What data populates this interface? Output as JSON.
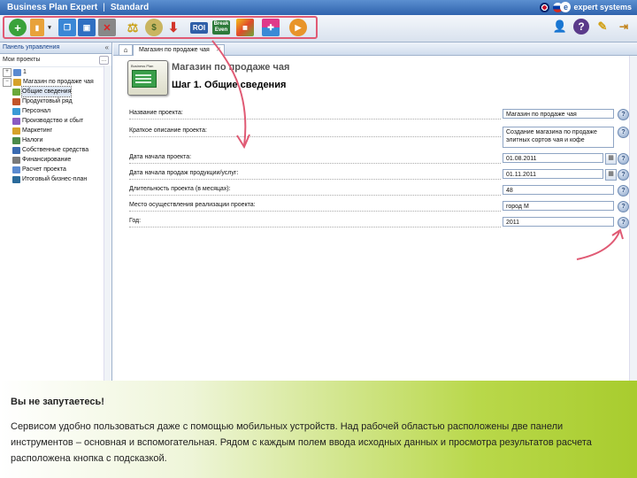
{
  "app": {
    "brand": "Business Plan Expert",
    "separator": "|",
    "edition": "Standard",
    "logo_text": "expert systems"
  },
  "toolbar": {
    "buttons": [
      {
        "name": "add-icon",
        "glyph": "+"
      },
      {
        "name": "open-icon",
        "glyph": "▮"
      },
      {
        "name": "copy-icon",
        "glyph": "❐"
      },
      {
        "name": "save-icon",
        "glyph": "💾"
      },
      {
        "name": "delete-icon",
        "glyph": "✕"
      },
      {
        "name": "balance-icon",
        "glyph": "⚖"
      },
      {
        "name": "money-bag-icon",
        "glyph": "$"
      },
      {
        "name": "export-icon",
        "glyph": "↓"
      }
    ],
    "roi_label": "ROI",
    "break_even_label": "Break Even",
    "right_buttons": [
      "users-icon",
      "help-icon",
      "edit-icon",
      "exit-icon"
    ]
  },
  "left_panel": {
    "title": "Панель управления",
    "projects_label": "Мои проекты",
    "tree": [
      {
        "label": "1",
        "level": 1,
        "toggle": "+"
      },
      {
        "label": "Магазин по продаже чая",
        "level": 1,
        "toggle": "−"
      },
      {
        "label": "Общие сведения",
        "level": 2,
        "selected": true
      },
      {
        "label": "Продуктовый ряд",
        "level": 2
      },
      {
        "label": "Персонал",
        "level": 2
      },
      {
        "label": "Производство и сбыт",
        "level": 2
      },
      {
        "label": "Маркетинг",
        "level": 2
      },
      {
        "label": "Налоги",
        "level": 2
      },
      {
        "label": "Собственные средства",
        "level": 2
      },
      {
        "label": "Финансирование",
        "level": 2
      },
      {
        "label": "Расчет проекта",
        "level": 2
      },
      {
        "label": "Итоговый бизнес-план",
        "level": 2
      }
    ]
  },
  "tabs": {
    "active_label": "Магазин по продаже чая"
  },
  "main": {
    "shop_title": "Магазин по продаже чая",
    "step_title": "Шаг 1. Общие сведения",
    "icon_caption": "Business Plan",
    "fields": [
      {
        "label": "Название проекта:",
        "value": "Магазин по продаже чая"
      },
      {
        "label": "Краткое описание проекта:",
        "value": "Создание магазина по продаже\nэлитных сортов чая и кофе"
      },
      {
        "label": "Дата начала проекта:",
        "value": "01.08.2011"
      },
      {
        "label": "Дата начала продаж продукции/услуг:",
        "value": "01.11.2011"
      },
      {
        "label": "Длительность проекта (в месяцах):",
        "value": "48"
      },
      {
        "label": "Место осуществления реализации проекта:",
        "value": "город М"
      },
      {
        "label": "Год:",
        "value": "2011"
      }
    ]
  },
  "info": {
    "title": "Вы не запутаетесь!",
    "body": "Сервисом удобно пользоваться даже с помощью мобильных устройств. Над рабочей областью расположены две панели инструментов – основная и вспомогательная. Рядом с каждым полем ввода исходных данных и просмотра результатов расчета расположена кнопка с подсказкой."
  },
  "colors": {
    "titlebar": "#2f63ad",
    "highlight": "#e05a74",
    "info_green": "#a8cc2e"
  }
}
